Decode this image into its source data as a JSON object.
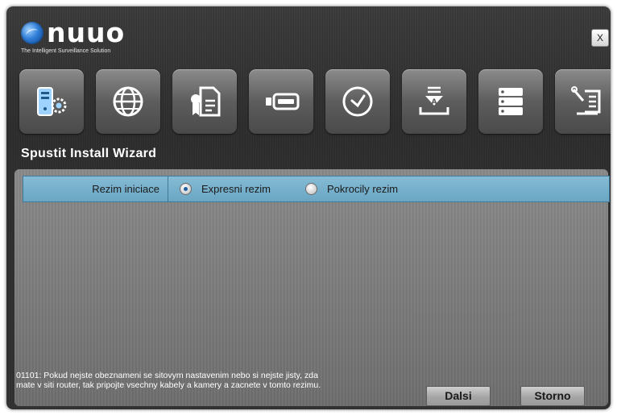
{
  "header": {
    "logo_text": "nuuo",
    "tagline": "The Intelligent Surveillance Solution",
    "close_label": "X"
  },
  "toolbar": {
    "icons": [
      "server-settings-icon",
      "globe-icon",
      "license-certificate-icon",
      "storage-drive-icon",
      "clock-icon",
      "download-install-icon",
      "server-rack-icon",
      "tools-manual-icon"
    ]
  },
  "page": {
    "title": "Spustit Install Wizard"
  },
  "mode": {
    "label": "Rezim iniciace",
    "options": [
      {
        "label": "Expresni rezim",
        "selected": true
      },
      {
        "label": "Pokrocily rezim",
        "selected": false
      }
    ]
  },
  "info": {
    "message": "01101: Pokud nejste obeznameni se sitovym nastavenim nebo si nejste jisty, zda mate v siti router, tak pripojte vsechny kabely a kamery a zacnete v tomto rezimu."
  },
  "footer": {
    "next_label": "Dalsi",
    "cancel_label": "Storno"
  },
  "colors": {
    "accent_row": "#7ab3cf",
    "window_bg": "#333333",
    "panel_bg": "#7c7c7c"
  }
}
